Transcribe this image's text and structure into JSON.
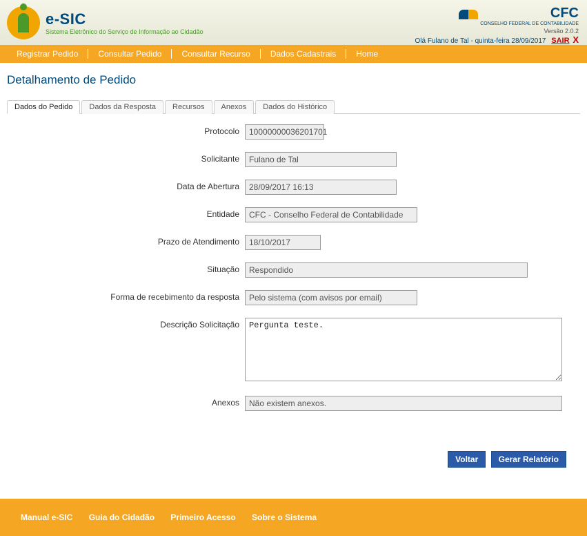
{
  "brand": {
    "title": "e-SIC",
    "subtitle": "Sistema Eletrônico do Serviço de Informação ao Cidadão"
  },
  "org": {
    "name": "CFC",
    "sub": "CONSELHO FEDERAL DE CONTABILIDADE"
  },
  "version": "Versão 2.0.2",
  "userline": "Olá Fulano de Tal - quinta-feira 28/09/2017",
  "sair": "SAIR",
  "menu": {
    "registrar": "Registrar Pedido",
    "consultar_pedido": "Consultar Pedido",
    "consultar_recurso": "Consultar Recurso",
    "dados_cadastrais": "Dados Cadastrais",
    "home": "Home"
  },
  "page_title": "Detalhamento de Pedido",
  "tabs": {
    "t0": "Dados do Pedido",
    "t1": "Dados da Resposta",
    "t2": "Recursos",
    "t3": "Anexos",
    "t4": "Dados do Histórico"
  },
  "labels": {
    "protocolo": "Protocolo",
    "solicitante": "Solicitante",
    "data_abertura": "Data de Abertura",
    "entidade": "Entidade",
    "prazo": "Prazo de Atendimento",
    "situacao": "Situação",
    "forma": "Forma de recebimento da resposta",
    "descricao": "Descrição Solicitação",
    "anexos": "Anexos"
  },
  "values": {
    "protocolo": "10000000036201701",
    "solicitante": "Fulano de Tal",
    "data_abertura": "28/09/2017 16:13",
    "entidade": "CFC - Conselho Federal de Contabilidade",
    "prazo": "18/10/2017",
    "situacao": "Respondido",
    "forma": "Pelo sistema (com avisos por email)",
    "descricao": "Pergunta teste.",
    "anexos": "Não existem anexos."
  },
  "buttons": {
    "voltar": "Voltar",
    "gerar": "Gerar Relatório"
  },
  "footer": {
    "manual": "Manual e-SIC",
    "guia": "Guia do Cidadão",
    "primeiro": "Primeiro Acesso",
    "sobre": "Sobre o Sistema"
  }
}
